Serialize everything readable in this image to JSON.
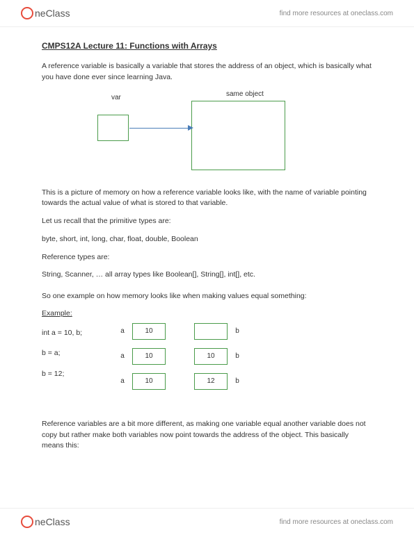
{
  "header": {
    "logo_text": "neClass",
    "link_text": "find more resources at oneclass.com"
  },
  "title": "CMPS12A Lecture 11: Functions with Arrays",
  "intro": "A reference variable is basically a variable that stores the address of an object, which is basically what you have done ever since learning Java.",
  "diagram": {
    "var_label": "var",
    "same_object_label": "same object"
  },
  "para2": "This is a picture of memory on how a reference variable looks like, with the name of variable pointing towards the actual value of what is stored to that variable.",
  "para3": "Let us recall that the primitive types are:",
  "primitives": "byte, short, int, long, char, float, double, Boolean",
  "para4": "Reference types are:",
  "reftypes": "String, Scanner, … all array types like Boolean[], String[], int[], etc.",
  "para5": "So one example on how memory looks like when making values equal something:",
  "example": {
    "label": "Example:",
    "code": {
      "line1": "int a = 10, b;",
      "line2": "b = a;",
      "line3": "b = 12;"
    },
    "rows": [
      {
        "a_label": "a",
        "a_val": "10",
        "b_val": "",
        "b_label": "b"
      },
      {
        "a_label": "a",
        "a_val": "10",
        "b_val": "10",
        "b_label": "b"
      },
      {
        "a_label": "a",
        "a_val": "10",
        "b_val": "12",
        "b_label": "b"
      }
    ]
  },
  "para6": "Reference variables are a bit more different, as making one variable equal another variable does not copy but rather make both variables now point towards the address of the object. This basically means this:",
  "footer": {
    "logo_text": "neClass",
    "link_text": "find more resources at oneclass.com"
  }
}
